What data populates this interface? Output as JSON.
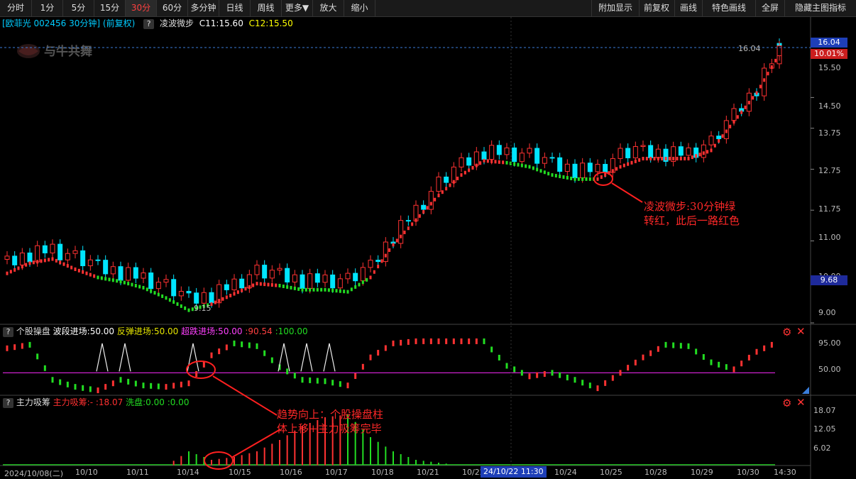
{
  "toolbar": {
    "left": [
      "分时",
      "1分",
      "5分",
      "15分",
      "30分",
      "60分",
      "多分钟",
      "日线",
      "周线",
      "更多▼",
      "放大",
      "缩小"
    ],
    "active": "30分",
    "right": [
      "附加显示",
      "前复权",
      "画线",
      "特色画线",
      "全屏",
      "隐藏主图指标"
    ]
  },
  "header": {
    "stock": "[欧菲光 002456 30分钟]",
    "adjust": "(前复权)",
    "indicator": "凌波微步",
    "c1": "C11:15.60",
    "c2": "C12:15.50",
    "qmark": "?"
  },
  "watermark": "与牛共舞",
  "colors": {
    "up": "#ff3232",
    "down": "#00e5ff",
    "green": "#22dd22",
    "magenta": "#cc22cc",
    "yellow": "#e5e500",
    "axis": "#bbbbbb"
  },
  "main_axis": {
    "ticks": [
      "15.50",
      "14.50",
      "13.75",
      "12.75",
      "11.75",
      "11.00",
      "10.00",
      "9.00"
    ],
    "price_box": "16.04",
    "pct_box": "10.01%",
    "low_box": "9.68"
  },
  "labels": {
    "high": "16.04",
    "low": "9.15"
  },
  "panel1": {
    "name": "个股操盘",
    "l1": "波段进场:50.00",
    "l2": "反弹进场:50.00",
    "l3": "超跌进场:50.00",
    "l4": ":90.54",
    "l5": ":100.00",
    "ticks": [
      "95.00",
      "50.00"
    ]
  },
  "panel2": {
    "name": "主力吸筹",
    "l1": "主力吸筹:-  :18.07",
    "l2": "洗盘:0.00",
    "l3": ":0.00",
    "ticks": [
      "18.07",
      "12.05",
      "6.02"
    ]
  },
  "xaxis": [
    "2024/10/08(二)",
    "10/10",
    "10/11",
    "10/14",
    "10/15",
    "10/16",
    "10/17",
    "10/18",
    "10/21",
    "10/22",
    "10/24",
    "10/25",
    "10/28",
    "10/29",
    "10/30",
    "14:30"
  ],
  "cursor_label": "24/10/22 11:30",
  "annotations": {
    "a1": [
      "凌波微步:30分钟绿",
      "转红，此后一路红色"
    ],
    "a2": [
      "趋势向上：个股操盘柱",
      "体上移+主力吸筹完毕"
    ]
  },
  "chart_data": [
    {
      "type": "line",
      "title": "凌波微步",
      "ylim": [
        9.0,
        16.1
      ],
      "x": [
        0,
        4,
        8,
        12,
        16,
        20,
        24,
        28,
        32,
        36,
        40,
        44,
        48,
        52,
        56,
        60,
        64,
        68,
        72,
        76,
        80,
        84,
        88,
        92,
        96,
        100,
        104,
        108,
        112,
        116,
        120,
        124,
        128,
        132,
        136
      ],
      "series": [
        {
          "name": "凌波微步",
          "values": [
            10.2,
            10.45,
            10.55,
            10.3,
            10.1,
            10.0,
            9.85,
            9.6,
            9.3,
            9.45,
            9.7,
            9.95,
            9.9,
            9.8,
            9.8,
            9.75,
            10.1,
            10.9,
            11.5,
            12.1,
            12.6,
            12.95,
            12.9,
            12.8,
            12.6,
            12.5,
            12.5,
            12.8,
            13.0,
            13.0,
            13.0,
            13.2,
            13.9,
            14.6,
            15.55
          ]
        }
      ]
    },
    {
      "type": "line",
      "title": "个股操盘",
      "ylim": [
        20,
        100
      ],
      "series": [
        {
          "name": "波段进场",
          "values": [
            50,
            50,
            50,
            50,
            50,
            50,
            50,
            50,
            50,
            50,
            50,
            50,
            50,
            50,
            50,
            50,
            50,
            50,
            50,
            50,
            50,
            50,
            50,
            50,
            50,
            50,
            50,
            50,
            50,
            50,
            50,
            50,
            50,
            50,
            50
          ]
        },
        {
          "name": "个股操盘",
          "values": [
            85,
            90,
            40,
            30,
            25,
            40,
            32,
            30,
            35,
            75,
            92,
            88,
            58,
            40,
            38,
            32,
            72,
            92,
            95,
            95,
            95,
            95,
            60,
            45,
            50,
            40,
            28,
            50,
            72,
            90,
            88,
            65,
            55,
            80,
            95
          ]
        }
      ]
    },
    {
      "type": "bar",
      "title": "主力吸筹",
      "ylim": [
        0,
        20
      ],
      "series": [
        {
          "name": "主力吸筹",
          "values": [
            0,
            0,
            0,
            0,
            0,
            0,
            0,
            0,
            5,
            2,
            3,
            5,
            9,
            14,
            17,
            18,
            10,
            5,
            2,
            1,
            0,
            0,
            0,
            0,
            0,
            0,
            0,
            0,
            0,
            0,
            0,
            0,
            0,
            0,
            0
          ]
        }
      ]
    }
  ]
}
